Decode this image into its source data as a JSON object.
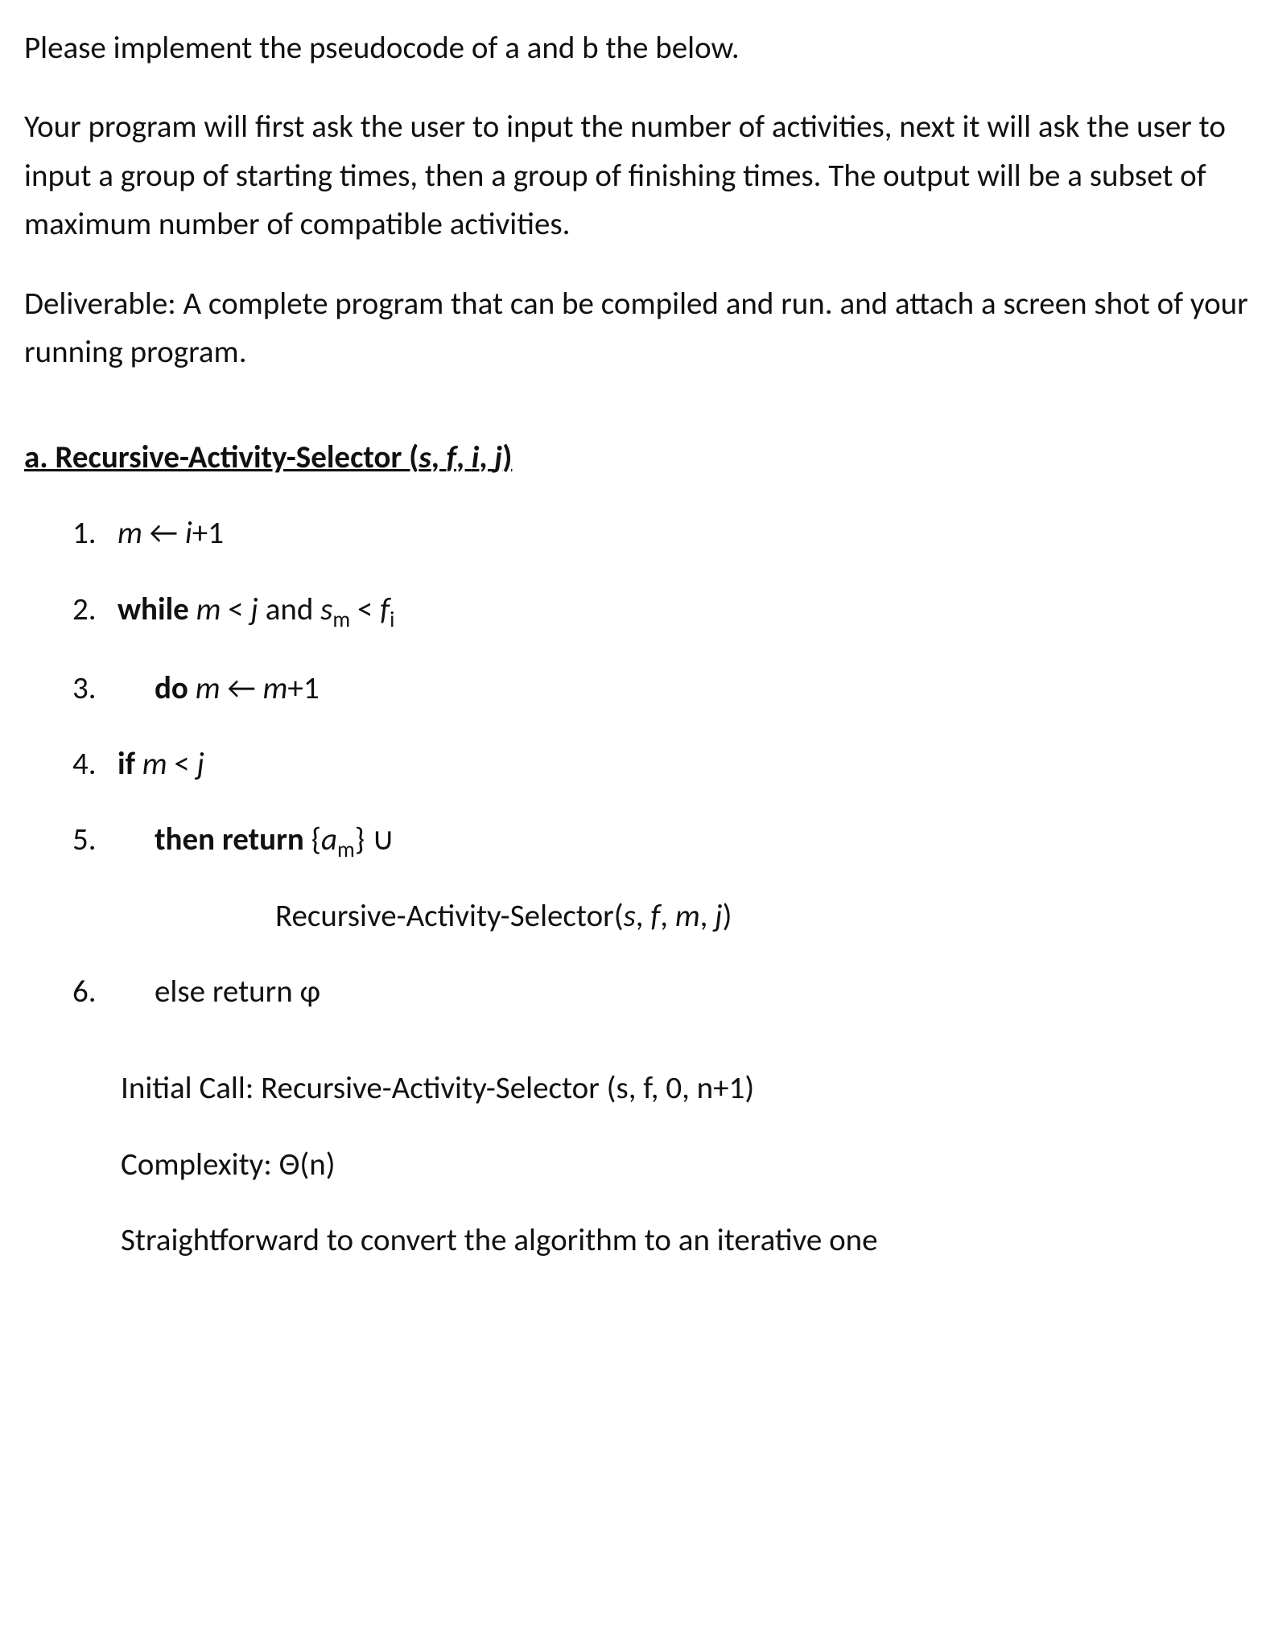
{
  "intro": {
    "p1": "Please implement the pseudocode of a and b the below.",
    "p2": "Your program will first ask the user to input the number of activities, next it will ask the user to input a group of starting times, then a group of finishing times. The output will be a subset of maximum number of compatible activities.",
    "p3": "Deliverable: A complete program that can be compiled and run. and attach a screen shot of your running program."
  },
  "section_a": {
    "heading_prefix": "a. Recursive-Activity-Selector (",
    "heading_args_s": "s",
    "heading_args_c1": ", ",
    "heading_args_f": "f",
    "heading_args_c2": ", ",
    "heading_args_i": "i",
    "heading_args_c3": ", ",
    "heading_args_j": "j",
    "heading_suffix": ")",
    "steps": {
      "s1": {
        "num": "1.",
        "m": "m",
        "arrow": " ← ",
        "i": "i",
        "rest": "+1"
      },
      "s2": {
        "num": "2.",
        "while": "while ",
        "m": "m",
        "lt1": " < ",
        "j": "j",
        "and": " and ",
        "s": "s",
        "sub_m": "m",
        "lt2": " < ",
        "f": "f",
        "sub_i": "i"
      },
      "s3": {
        "num": "3.",
        "do": "do ",
        "m1": "m",
        "arrow": " ← ",
        "m2": "m",
        "rest": "+1"
      },
      "s4": {
        "num": "4.",
        "if": "if  ",
        "m": "m",
        "lt": " < ",
        "j": "j"
      },
      "s5": {
        "num": "5.",
        "then": "then return ",
        "lbrace": "{",
        "a": "a",
        "sub_m": "m",
        "rbrace": "} ",
        "cup": "∪",
        "recurse_name": "Recursive-Activity-Selector(",
        "s": "s",
        "c1": ", ",
        "f": "f",
        "c2": ", ",
        "m": "m",
        "c3": ", ",
        "j": "j",
        "close": ")"
      },
      "s6": {
        "num": "6.",
        "else": "else return ",
        "phi": "ɸ"
      }
    },
    "notes": {
      "initial_call": "Initial Call: Recursive-Activity-Selector (s, f, 0, n+1)",
      "complexity_label": "Complexity: ",
      "complexity_value": "Θ(n)",
      "straightforward": "Straightforward to convert the algorithm to an iterative one"
    }
  }
}
